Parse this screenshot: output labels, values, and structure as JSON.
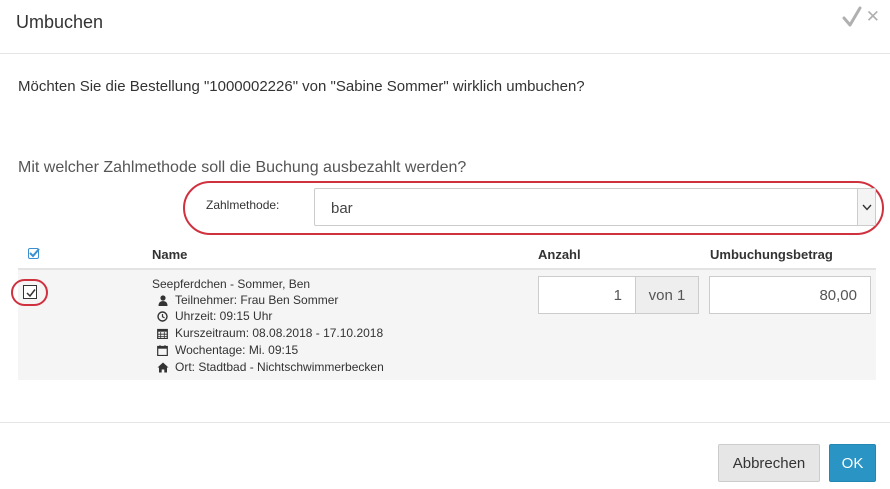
{
  "dialog": {
    "title": "Umbuchen",
    "question": "Möchten Sie die Bestellung \"1000002226\" von \"Sabine Sommer\" wirklich umbuchen?",
    "payment_question": "Mit welcher Zahlmethode soll die Buchung ausbezahlt werden?",
    "payment_method": {
      "label": "Zahlmethode:",
      "selected": "bar"
    }
  },
  "table": {
    "headers": {
      "name": "Name",
      "quantity": "Anzahl",
      "amount": "Umbuchungsbetrag"
    },
    "rows": [
      {
        "checked": true,
        "name": "Seepferdchen - Sommer, Ben",
        "details": {
          "participant": "Teilnehmer: Frau Ben Sommer",
          "time": "Uhrzeit: 09:15 Uhr",
          "period": "Kurszeitraum: 08.08.2018 - 17.10.2018",
          "weekdays": "Wochentage: Mi. 09:15",
          "location": "Ort: Stadtbad - Nichtschwimmerbecken"
        },
        "quantity": "1",
        "quantity_of": "von 1",
        "amount": "80,00"
      }
    ]
  },
  "footer": {
    "cancel_label": "Abbrechen",
    "ok_label": "OK"
  },
  "colors": {
    "primary": "#2a94c4",
    "highlight": "#d0313f"
  }
}
